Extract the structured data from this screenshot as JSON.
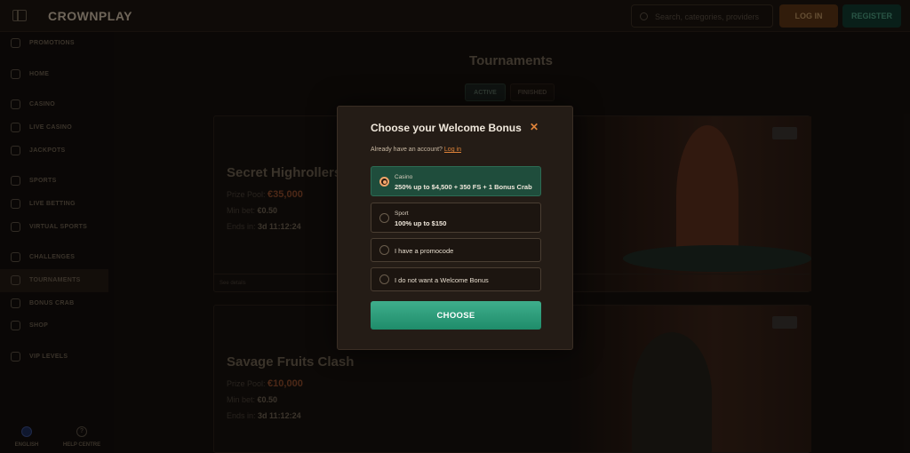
{
  "header": {
    "logo": "CROWNPLAY",
    "search_placeholder": "Search, categories, providers",
    "login_label": "LOG IN",
    "register_label": "REGISTER"
  },
  "sidebar": {
    "items": [
      {
        "label": "PROMOTIONS",
        "icon": "gift-icon"
      },
      {
        "label": "HOME",
        "icon": "home-icon"
      },
      {
        "label": "CASINO",
        "icon": "casino-icon"
      },
      {
        "label": "LIVE CASINO",
        "icon": "spade-icon"
      },
      {
        "label": "JACKPOTS",
        "icon": "jackpot-icon"
      },
      {
        "label": "SPORTS",
        "icon": "ball-icon"
      },
      {
        "label": "LIVE BETTING",
        "icon": "live-icon"
      },
      {
        "label": "VIRTUAL SPORTS",
        "icon": "virtual-icon"
      },
      {
        "label": "CHALLENGES",
        "icon": "challenge-icon"
      },
      {
        "label": "TOURNAMENTS",
        "icon": "trophy-icon"
      },
      {
        "label": "BONUS CRAB",
        "icon": "crab-icon"
      },
      {
        "label": "SHOP",
        "icon": "shop-icon"
      },
      {
        "label": "VIP LEVELS",
        "icon": "crown-icon"
      }
    ],
    "language_label": "ENGLISH",
    "help_label": "HELP CENTRE"
  },
  "main": {
    "title": "Tournaments",
    "tabs": [
      {
        "label": "ACTIVE"
      },
      {
        "label": "FINISHED"
      }
    ],
    "cards": [
      {
        "name": "Secret Highrollers",
        "prize_label": "Prize Pool:",
        "prize": "€35,000",
        "min_bet_label": "Min bet:",
        "min_bet": "€0.50",
        "ends_label": "Ends in:",
        "ends": "3d 11:12:24",
        "footer": "See details"
      },
      {
        "name": "Savage Fruits Clash",
        "prize_label": "Prize Pool:",
        "prize": "€10,000",
        "min_bet_label": "Min bet:",
        "min_bet": "€0.50",
        "ends_label": "Ends in:",
        "ends": "3d 11:12:24"
      }
    ]
  },
  "modal": {
    "title": "Choose your Welcome Bonus",
    "account_text": "Already have an account?",
    "login_link": "Log in",
    "options": [
      {
        "line1": "Casino",
        "line2": "250% up to $4,500 + 350 FS + 1 Bonus Crab",
        "selected": true
      },
      {
        "line1": "Sport",
        "line2": "100% up to $150",
        "selected": false
      },
      {
        "line1": "I have a promocode",
        "selected": false
      },
      {
        "line1": "I do not want a Welcome Bonus",
        "selected": false
      }
    ],
    "choose_label": "CHOOSE"
  },
  "colors": {
    "accent_orange": "#e0843a",
    "accent_green": "#1f8c6a",
    "modal_bg": "#241c16"
  }
}
